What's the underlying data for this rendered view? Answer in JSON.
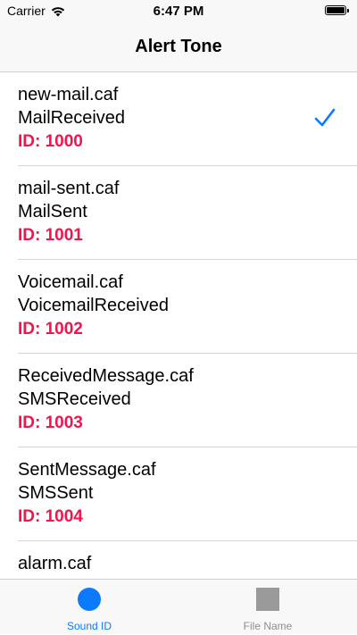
{
  "status_bar": {
    "carrier": "Carrier",
    "time": "6:47 PM"
  },
  "nav": {
    "title": "Alert Tone"
  },
  "list": {
    "items": [
      {
        "file": "new-mail.caf",
        "sound": "MailReceived",
        "id": "ID: 1000",
        "selected": true
      },
      {
        "file": "mail-sent.caf",
        "sound": "MailSent",
        "id": "ID: 1001",
        "selected": false
      },
      {
        "file": "Voicemail.caf",
        "sound": "VoicemailReceived",
        "id": "ID: 1002",
        "selected": false
      },
      {
        "file": "ReceivedMessage.caf",
        "sound": "SMSReceived",
        "id": "ID: 1003",
        "selected": false
      },
      {
        "file": "SentMessage.caf",
        "sound": "SMSSent",
        "id": "ID: 1004",
        "selected": false
      },
      {
        "file": "alarm.caf",
        "sound": "",
        "id": "",
        "selected": false
      }
    ]
  },
  "tabs": [
    {
      "label": "Sound ID",
      "icon": "circle-icon",
      "active": true
    },
    {
      "label": "File Name",
      "icon": "square-icon",
      "active": false
    }
  ],
  "colors": {
    "accent": "#0a7aff",
    "id_text": "#f5134d",
    "inactive_tab": "#8e8e93"
  }
}
